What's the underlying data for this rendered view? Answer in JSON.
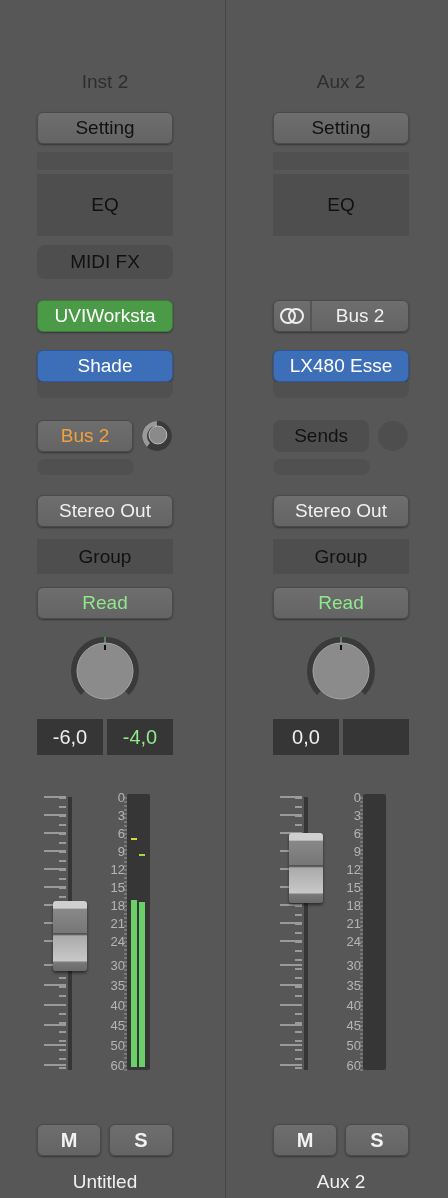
{
  "strips": [
    {
      "title": "Inst 2",
      "setting": "Setting",
      "eq": "EQ",
      "midi_fx": "MIDI FX",
      "input": {
        "kind": "instrument",
        "label": "UVIWorksta"
      },
      "effects": [
        {
          "kind": "audio_fx",
          "label": "Shade"
        }
      ],
      "send": {
        "kind": "bus",
        "label": "Bus 2"
      },
      "output": "Stereo Out",
      "group": "Group",
      "automation": "Read",
      "volume_readout": "-6,0",
      "peak_readout": "-4,0",
      "fader": {
        "level": 0.49
      },
      "meter_scale": [
        "0",
        "3",
        "6",
        "9",
        "12",
        "15",
        "18",
        "21",
        "24",
        "30",
        "35",
        "40",
        "45",
        "50",
        "60"
      ],
      "meter": [
        {
          "level": 0.62
        },
        {
          "level": 0.61
        }
      ],
      "mute": {
        "label": "M",
        "on": false
      },
      "solo": {
        "label": "S",
        "on": false
      },
      "name": "Untitled"
    },
    {
      "title": "Aux 2",
      "setting": "Setting",
      "eq": "EQ",
      "input": {
        "kind": "bus",
        "label": "Bus 2"
      },
      "effects": [
        {
          "kind": "audio_fx",
          "label": "LX480 Esse"
        }
      ],
      "send": {
        "kind": "empty",
        "label": "Sends"
      },
      "output": "Stereo Out",
      "group": "Group",
      "automation": "Read",
      "volume_readout": "0,0",
      "fader": {
        "level": 0.74
      },
      "meter_scale": [
        "0",
        "3",
        "6",
        "9",
        "12",
        "15",
        "18",
        "21",
        "24",
        "30",
        "35",
        "40",
        "45",
        "50",
        "60"
      ],
      "mute": {
        "label": "M",
        "on": false
      },
      "solo": {
        "label": "S",
        "on": false
      },
      "name": "Aux 2"
    }
  ]
}
